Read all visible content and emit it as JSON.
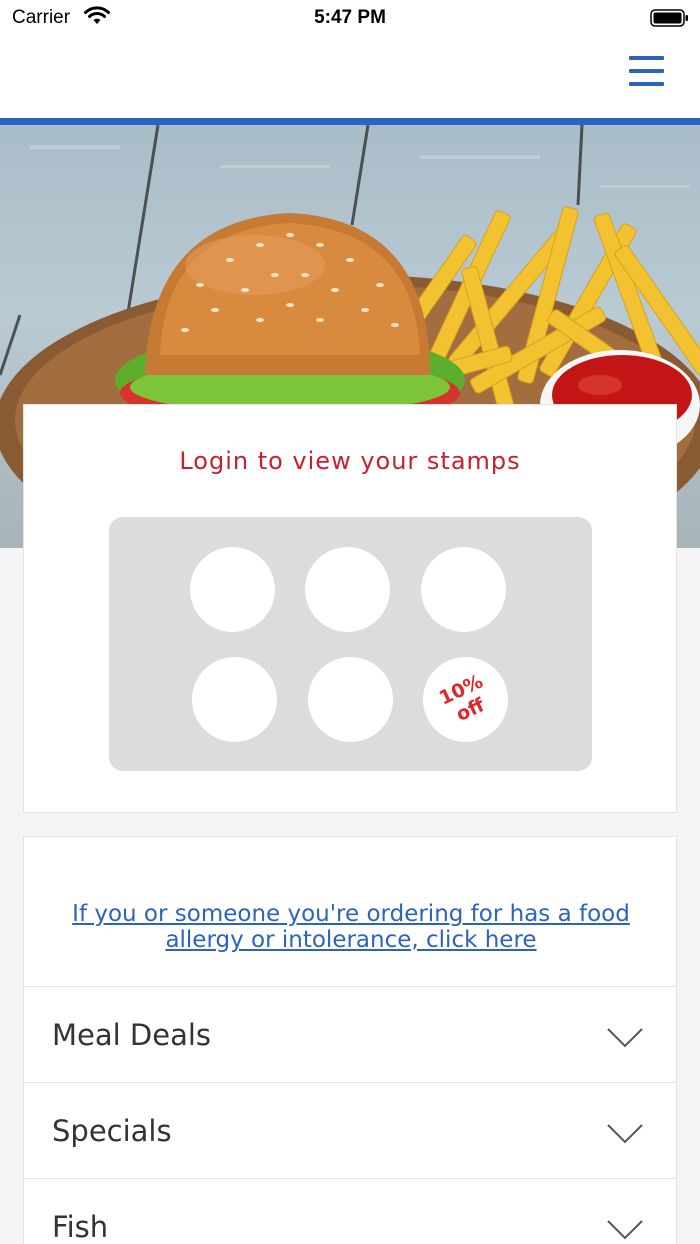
{
  "status_bar": {
    "carrier": "Carrier",
    "time": "5:47 PM",
    "icons": [
      "wifi-icon",
      "battery-icon"
    ]
  },
  "nav": {
    "menu_icon": "hamburger-menu-icon",
    "accent_color": "#2c63bd"
  },
  "hero": {
    "image_description_icon": "burger-and-fries-photo"
  },
  "stamp_card": {
    "title": "Login to view your stamps",
    "title_color": "#c8202d",
    "total_stamps": 6,
    "collected_stamps": 0,
    "reward_line1": "10%",
    "reward_line2": "off",
    "reward_color": "#e3262b"
  },
  "allergy": {
    "link_text": "If you or someone you're ordering for has a food allergy or intolerance, click here",
    "link_color": "#2c63bd"
  },
  "menu_categories": [
    {
      "label": "Meal Deals",
      "icon": "chevron-down-icon"
    },
    {
      "label": "Specials",
      "icon": "chevron-down-icon"
    },
    {
      "label": "Fish",
      "icon": "chevron-down-icon"
    }
  ]
}
